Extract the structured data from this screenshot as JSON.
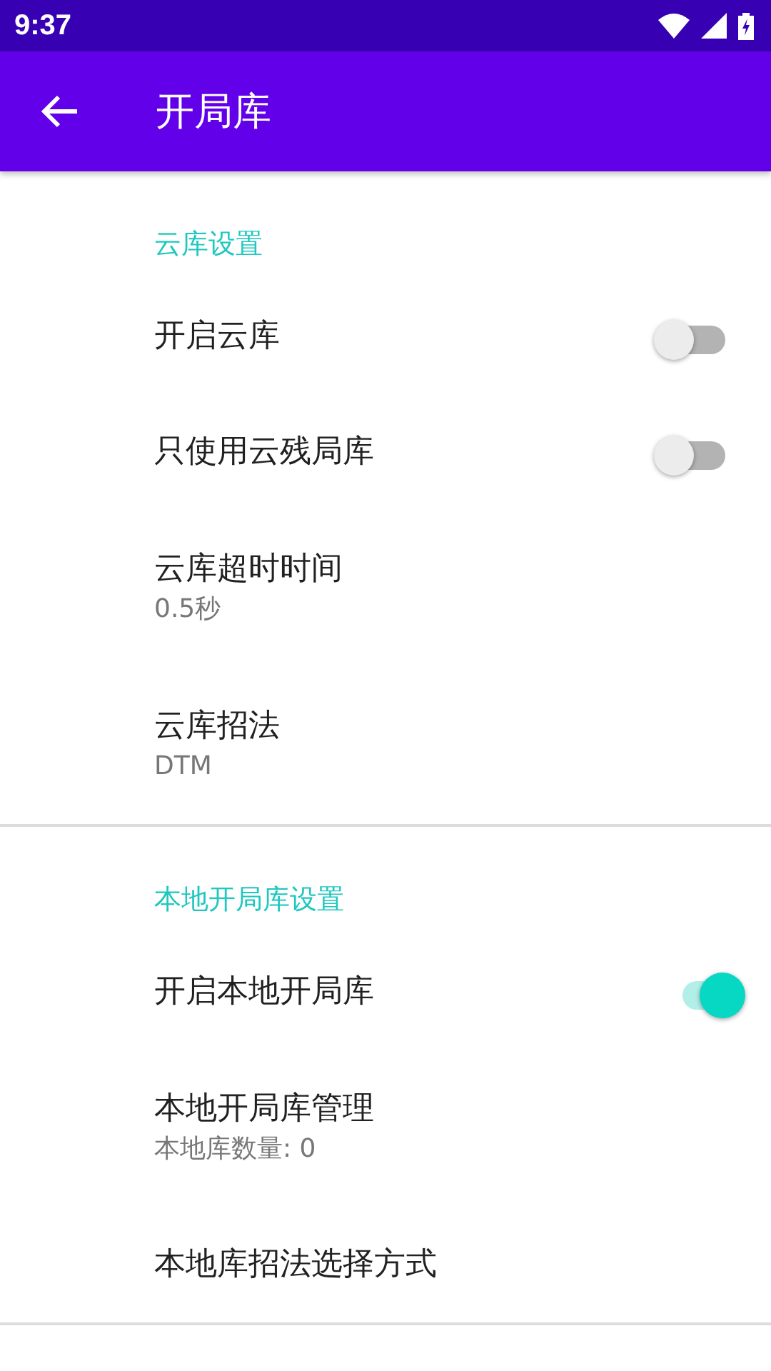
{
  "status_bar": {
    "time": "9:37"
  },
  "app_bar": {
    "title": "开局库"
  },
  "sections": [
    {
      "header": "云库设置",
      "items": [
        {
          "kind": "switch",
          "title": "开启云库",
          "on": false
        },
        {
          "kind": "switch",
          "title": "只使用云残局库",
          "on": false
        },
        {
          "kind": "text",
          "title": "云库超时时间",
          "summary": "0.5秒"
        },
        {
          "kind": "text",
          "title": "云库招法",
          "summary": "DTM"
        }
      ]
    },
    {
      "header": "本地开局库设置",
      "items": [
        {
          "kind": "switch",
          "title": "开启本地开局库",
          "on": true
        },
        {
          "kind": "text",
          "title": "本地开局库管理",
          "summary": "本地库数量: 0"
        },
        {
          "kind": "text",
          "title": "本地库招法选择方式"
        }
      ]
    }
  ]
}
